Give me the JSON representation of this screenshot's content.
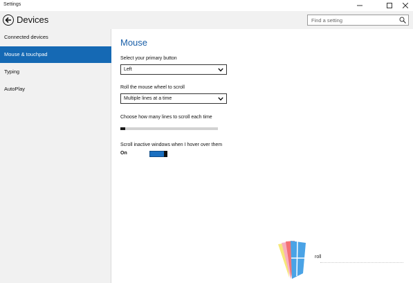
{
  "window": {
    "title": "Settings"
  },
  "header": {
    "section_title": "Devices",
    "search_placeholder": "Find a setting"
  },
  "sidebar": {
    "items": [
      {
        "label": "Connected devices",
        "active": false
      },
      {
        "label": "Mouse & touchpad",
        "active": true
      },
      {
        "label": "Typing",
        "active": false
      },
      {
        "label": "AutoPlay",
        "active": false
      }
    ]
  },
  "main": {
    "title": "Mouse",
    "primary_button": {
      "label": "Select your primary button",
      "value": "Left"
    },
    "scroll_mode": {
      "label": "Roll the mouse wheel to scroll",
      "value": "Multiple lines at a time"
    },
    "scroll_lines": {
      "label": "Choose how many lines to scroll each time",
      "fraction": 0.05
    },
    "inactive_scroll": {
      "label": "Scroll inactive windows when I hover over them",
      "state": "On"
    }
  },
  "watermark": {
    "text": "roll"
  },
  "colors": {
    "accent": "#1569b4",
    "title_blue": "#1a5fa8",
    "sidebar_bg": "#f1f1f1",
    "toggle_on": "#1a6fc0"
  },
  "icons": [
    "back-arrow-icon",
    "search-icon",
    "minimize-icon",
    "maximize-icon",
    "close-icon",
    "chevron-down-icon"
  ]
}
